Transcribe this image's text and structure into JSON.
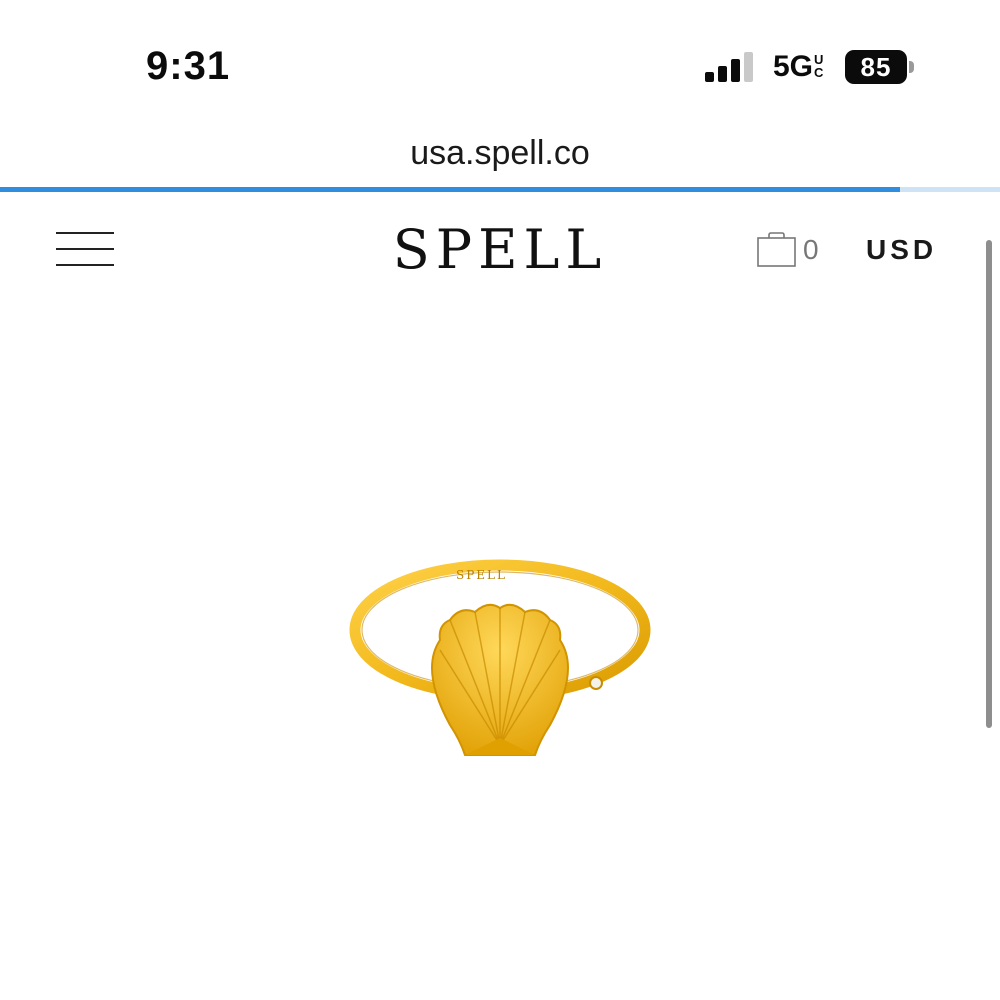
{
  "status_bar": {
    "time": "9:31",
    "network": "5G",
    "network_suffix_top": "U",
    "network_suffix_bottom": "C",
    "battery": "85",
    "signal_bars_active": 3,
    "signal_bars_total": 4
  },
  "browser": {
    "url": "usa.spell.co",
    "load_progress": 0.9,
    "progress_color": "#2f8fde"
  },
  "header": {
    "menu_icon": "hamburger-menu-icon",
    "logo": "SPELL",
    "cart_icon": "shopping-bag-icon",
    "cart_count": "0",
    "currency": "USD"
  },
  "product": {
    "image_description_icon": "gold-shell-ring-image",
    "engraving": "SPELL",
    "accent_color": "#f2b91c"
  }
}
